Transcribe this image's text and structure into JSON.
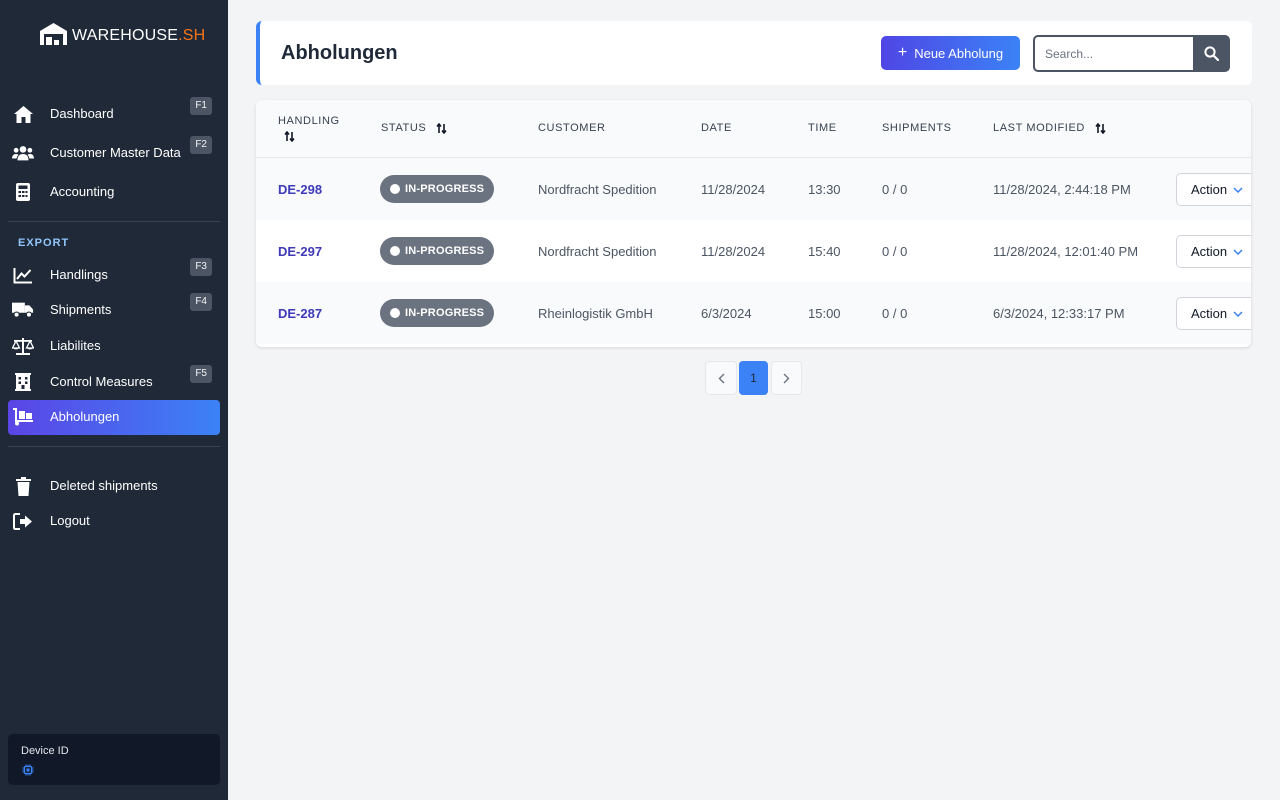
{
  "brand": {
    "name_main": "WAREHOUSE",
    "name_accent": ".SH",
    "accent_color": "#f97316"
  },
  "sidebar": {
    "items_top": [
      {
        "label": "Dashboard",
        "key": "F1",
        "icon": "home-icon"
      },
      {
        "label": "Customer Master Data",
        "key": "F2",
        "icon": "users-icon"
      },
      {
        "label": "Accounting",
        "key": "",
        "icon": "calculator-icon"
      }
    ],
    "section_export": "EXPORT",
    "items_export": [
      {
        "label": "Handlings",
        "key": "F3",
        "icon": "chart-line-icon"
      },
      {
        "label": "Shipments",
        "key": "F4",
        "icon": "truck-icon"
      },
      {
        "label": "Liabilites",
        "key": "",
        "icon": "scale-icon"
      },
      {
        "label": "Control Measures",
        "key": "F5",
        "icon": "building-icon"
      },
      {
        "label": "Abholungen",
        "key": "",
        "icon": "dolly-icon",
        "active": true
      }
    ],
    "items_bottom": [
      {
        "label": "Deleted shipments",
        "icon": "trash-icon"
      },
      {
        "label": "Logout",
        "icon": "logout-icon"
      }
    ],
    "device": {
      "label": "Device ID"
    }
  },
  "header": {
    "title": "Abholungen",
    "new_button": "Neue Abholung",
    "search_placeholder": "Search..."
  },
  "table": {
    "columns": [
      "HANDLING",
      "STATUS",
      "CUSTOMER",
      "DATE",
      "TIME",
      "SHIPMENTS",
      "LAST MODIFIED"
    ],
    "rows": [
      {
        "handling": "DE-298",
        "status": "IN-PROGRESS",
        "customer": "Nordfracht Spedition",
        "date": "11/28/2024",
        "time": "13:30",
        "shipments": "0 / 0",
        "last_modified": "11/28/2024, 2:44:18 PM",
        "action": "Action"
      },
      {
        "handling": "DE-297",
        "status": "IN-PROGRESS",
        "customer": "Nordfracht Spedition",
        "date": "11/28/2024",
        "time": "15:40",
        "shipments": "0 / 0",
        "last_modified": "11/28/2024, 12:01:40 PM",
        "action": "Action"
      },
      {
        "handling": "DE-287",
        "status": "IN-PROGRESS",
        "customer": "Rheinlogistik GmbH",
        "date": "6/3/2024",
        "time": "15:00",
        "shipments": "0 / 0",
        "last_modified": "6/3/2024, 12:33:17 PM",
        "action": "Action"
      }
    ]
  },
  "pagination": {
    "current": "1"
  },
  "colors": {
    "sidebar_bg": "#1f2937",
    "primary": "#3b82f6",
    "indigo": "#4f46e5",
    "status_gray": "#6b7280"
  }
}
